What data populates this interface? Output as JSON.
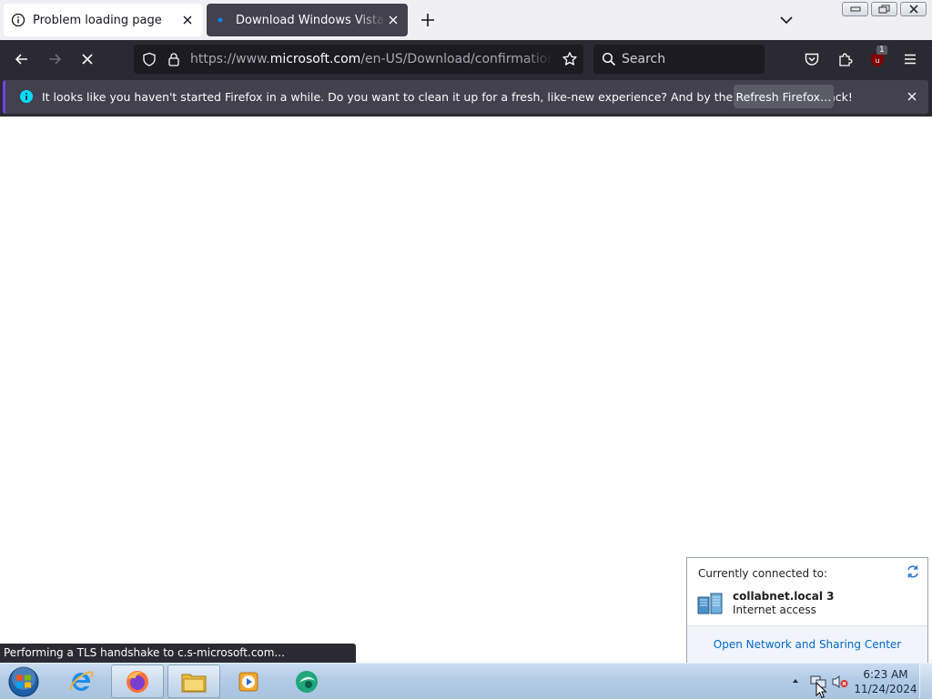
{
  "tabs": [
    {
      "title": "Problem loading page",
      "icon": "info-icon"
    },
    {
      "title": "Download Windows Vista Servi",
      "icon": "loading-dot-icon"
    }
  ],
  "nav": {
    "url_prefix": "https://www.",
    "url_domain": "microsoft.com",
    "url_path": "/en-US/Download/confirmation.aspx?id",
    "search_placeholder": "Search",
    "extension_badge": "1"
  },
  "notification": {
    "message": "It looks like you haven't started Firefox in a while. Do you want to clean it up for a fresh, like-new experience? And by the way, welcome back!",
    "button": "Refresh Firefox…"
  },
  "status_text": "Performing a TLS handshake to c.s-microsoft.com...",
  "network_flyout": {
    "header": "Currently connected to:",
    "network_name": "collabnet.local  3",
    "network_status": "Internet access",
    "link": "Open Network and Sharing Center"
  },
  "taskbar": {
    "apps": [
      "internet-explorer-icon",
      "firefox-icon",
      "file-explorer-icon",
      "media-player-icon",
      "app-icon"
    ],
    "time": "6:23 AM",
    "date": "11/24/2024"
  },
  "colors": {
    "chrome_dark": "#2b2a33",
    "url_field": "#1c1b22",
    "accent_purple": "#7542e5",
    "info_blue": "#00ddff",
    "link_blue": "#0066cc"
  }
}
